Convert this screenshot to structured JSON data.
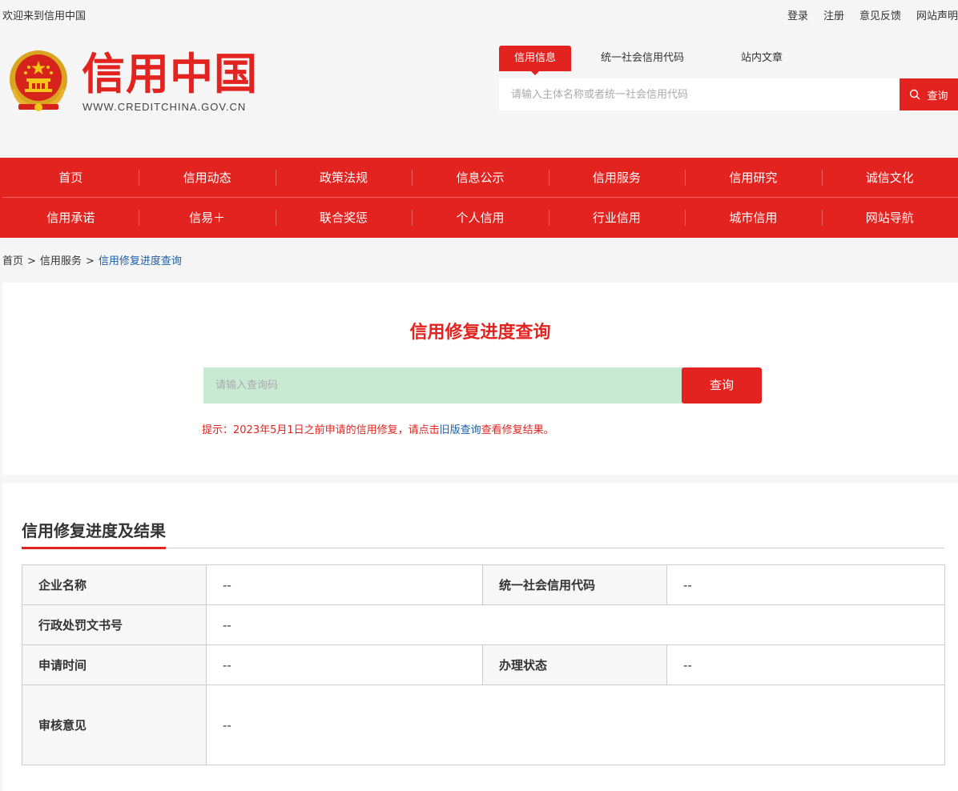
{
  "topbar": {
    "welcome": "欢迎来到信用中国",
    "links": [
      "登录",
      "注册",
      "意见反馈",
      "网站声明"
    ]
  },
  "header": {
    "logo_text": "信用中国",
    "logo_url": "WWW.CREDITCHINA.GOV.CN",
    "search_tabs": [
      "信用信息",
      "统一社会信用代码",
      "站内文章"
    ],
    "search_placeholder": "请输入主体名称或者统一社会信用代码",
    "search_button": "查询"
  },
  "nav": {
    "row1": [
      "首页",
      "信用动态",
      "政策法规",
      "信息公示",
      "信用服务",
      "信用研究",
      "诚信文化"
    ],
    "row2": [
      "信用承诺",
      "信易＋",
      "联合奖惩",
      "个人信用",
      "行业信用",
      "城市信用",
      "网站导航"
    ]
  },
  "breadcrumb": {
    "items": [
      "首页",
      "信用服务"
    ],
    "current": "信用修复进度查询",
    "separator": ">"
  },
  "query": {
    "title": "信用修复进度查询",
    "placeholder": "请输入查询码",
    "button": "查询",
    "tip_before": "提示：2023年5月1日之前申请的信用修复，请点击",
    "tip_link": "旧版查询",
    "tip_after": "查看修复结果。"
  },
  "result": {
    "title": "信用修复进度及结果",
    "rows": {
      "company_label": "企业名称",
      "company_value": "--",
      "code_label": "统一社会信用代码",
      "code_value": "--",
      "doc_label": "行政处罚文书号",
      "doc_value": "--",
      "time_label": "申请时间",
      "time_value": "--",
      "status_label": "办理状态",
      "status_value": "--",
      "opinion_label": "审核意见",
      "opinion_value": "--"
    }
  },
  "colors": {
    "brand_red": "#e3231f",
    "link_blue": "#1a5ea8",
    "input_green": "#c8ead3"
  }
}
